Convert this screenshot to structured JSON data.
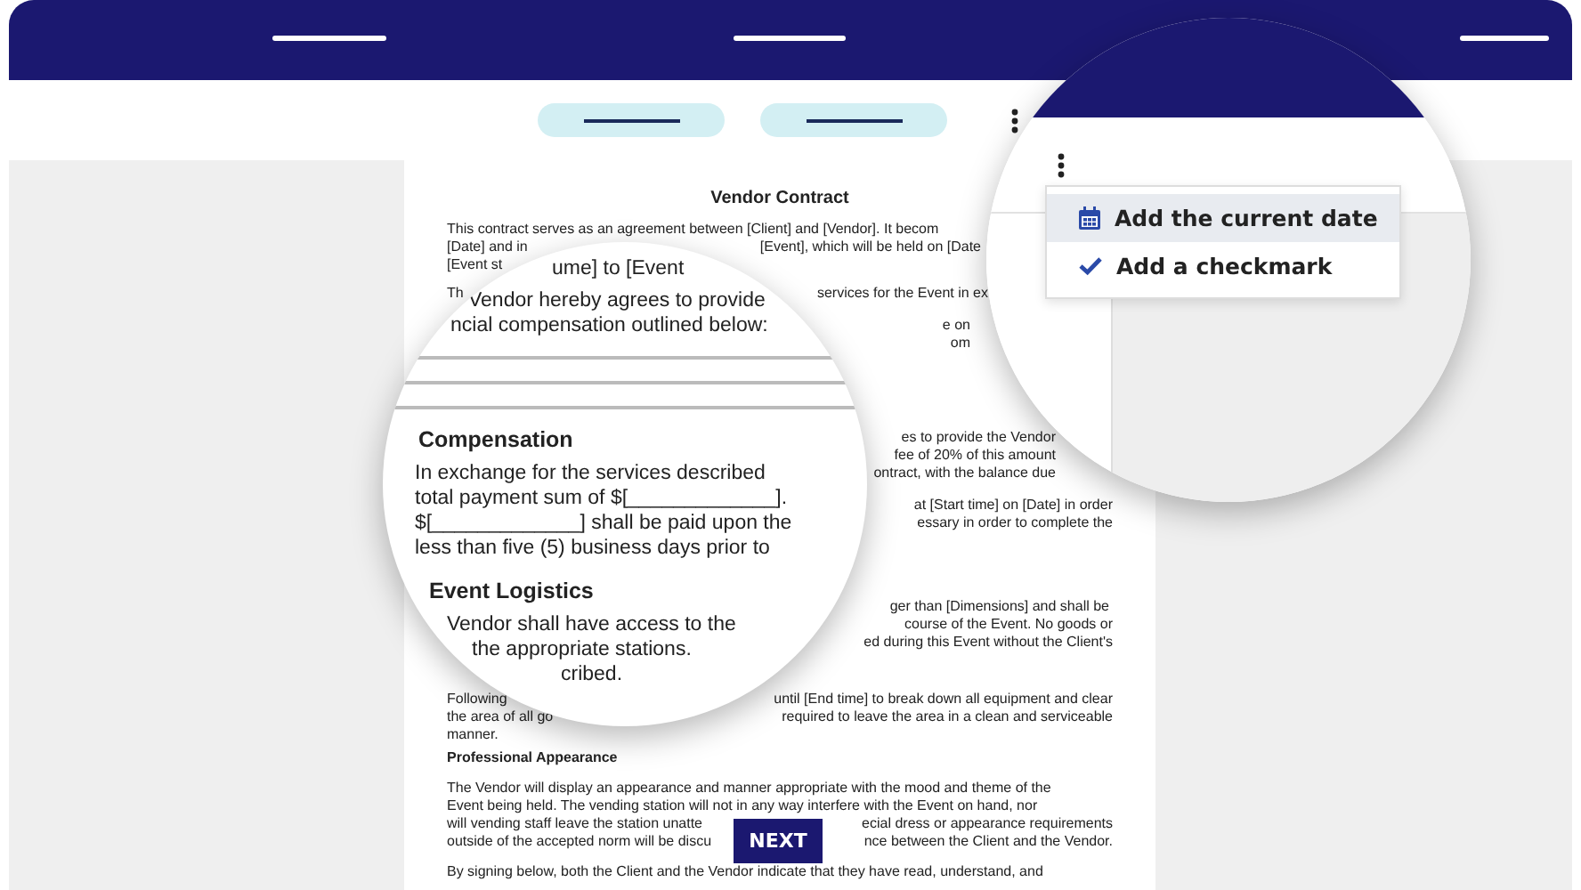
{
  "document": {
    "lines": [
      {
        "kind": "title",
        "parts": [
          "Vendor Contract"
        ]
      },
      {
        "kind": "para",
        "parts": [
          "This contract serves as an agreement between [Client] and [Vendor]. It becom"
        ]
      },
      {
        "kind": "upper",
        "parts": [
          "[Date] and in",
          "[Event], which will be held on [Date"
        ]
      },
      {
        "kind": "text",
        "parts": [
          "[Event st"
        ]
      },
      {
        "kind": "upper-para",
        "parts": [
          "Th",
          "services for the Event in ex"
        ]
      },
      {
        "kind": "upper-far",
        "parts": [
          "e on"
        ]
      },
      {
        "kind": "upper-right",
        "parts": [
          "om"
        ]
      },
      {
        "kind": "break-near",
        "parts": [
          "es to provide the Vendor"
        ]
      },
      {
        "kind": "near",
        "parts": [
          "fee of 20% of this amount"
        ]
      },
      {
        "kind": "near",
        "parts": [
          "ontract, with the balance due"
        ]
      },
      {
        "kind": "para-right",
        "parts": [
          "at [Start time] on [Date] in order"
        ]
      },
      {
        "kind": "right",
        "parts": [
          "essary in order to complete the"
        ]
      },
      {
        "kind": "break-right",
        "parts": [
          "ger than [Dimensions] and shall be"
        ]
      },
      {
        "kind": "right",
        "parts": [
          "course of the Event. No goods or"
        ]
      },
      {
        "kind": "right",
        "parts": [
          "ed during this Event without the Client's"
        ]
      },
      {
        "kind": "split-para",
        "parts": [
          "Following",
          "until [End time] to break down all equipment and clear"
        ]
      },
      {
        "kind": "split",
        "parts": [
          "the area of all go",
          "required to leave the area in a clean and serviceable"
        ]
      },
      {
        "kind": "text",
        "parts": [
          "manner."
        ]
      },
      {
        "kind": "heading",
        "parts": [
          "Professional Appearance"
        ]
      },
      {
        "kind": "para",
        "parts": [
          "The Vendor will display an appearance and manner appropriate with the mood and theme of the"
        ]
      },
      {
        "kind": "text",
        "parts": [
          "Event being held. The vending station will not in any way interfere with the Event on hand, nor"
        ]
      },
      {
        "kind": "split",
        "parts": [
          "will vending staff leave the station unatte",
          "ecial dress or appearance requirements"
        ]
      },
      {
        "kind": "split",
        "parts": [
          "outside of the accepted norm will be discu",
          "nce between the Client and the Vendor."
        ]
      },
      {
        "kind": "para",
        "parts": [
          "By signing below, both the Client and the Vendor indicate that they have read, understand, and"
        ]
      }
    ]
  },
  "next_button": "NEXT",
  "magnifier_left": {
    "intro": [
      "ume] to [Event",
      "Vendor hereby agrees to provide",
      "ncial compensation outlined below:"
    ],
    "sections": [
      {
        "heading": "Compensation",
        "lines": [
          "In exchange for the services described",
          "total payment sum of $[_____________].",
          "$[_____________] shall be paid upon the",
          "less than five (5) business days prior to"
        ]
      },
      {
        "heading": "Event Logistics",
        "lines": [
          "Vendor shall have access to the",
          "the appropriate stations.",
          "cribed."
        ]
      }
    ]
  },
  "magnifier_right": {
    "menu": [
      {
        "kind": "calendar",
        "label": "Add the current date",
        "selected": true
      },
      {
        "kind": "check",
        "label": "Add a checkmark",
        "selected": false
      }
    ]
  }
}
